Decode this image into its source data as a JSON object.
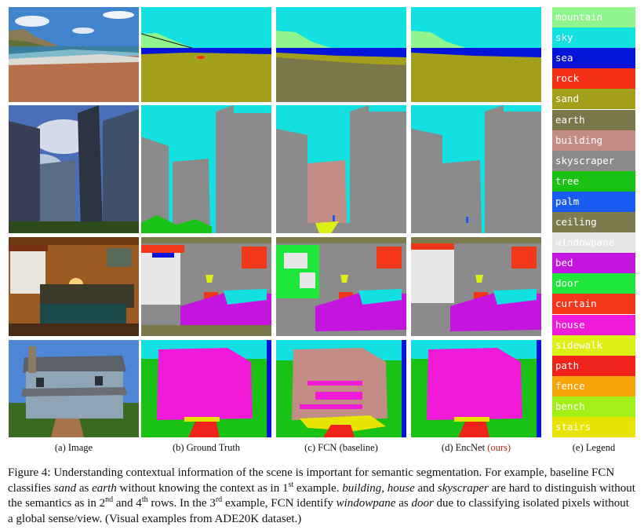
{
  "subcaptions": {
    "image": "(a) Image",
    "ground_truth": "(b) Ground Truth",
    "fcn": "(c) FCN (baseline)",
    "encnet_prefix": "(d) EncNet",
    "encnet_ours": "(ours)",
    "legend": "(e) Legend"
  },
  "legend": [
    {
      "label": "mountain",
      "color": "#8ff58c"
    },
    {
      "label": "sky",
      "color": "#13e0e0"
    },
    {
      "label": "sea",
      "color": "#0414d8"
    },
    {
      "label": "rock",
      "color": "#f52f16"
    },
    {
      "label": "sand",
      "color": "#a29f1b"
    },
    {
      "label": "earth",
      "color": "#7a774b"
    },
    {
      "label": "building",
      "color": "#c38c85"
    },
    {
      "label": "skyscraper",
      "color": "#8b8b8b"
    },
    {
      "label": "tree",
      "color": "#19c214"
    },
    {
      "label": "palm",
      "color": "#1a5bf2"
    },
    {
      "label": "ceiling",
      "color": "#7e7c4e"
    },
    {
      "label": "windowpane",
      "color": "#e6e6e6"
    },
    {
      "label": "bed",
      "color": "#c414e0"
    },
    {
      "label": "door",
      "color": "#1fe63a"
    },
    {
      "label": "curtain",
      "color": "#f2361a"
    },
    {
      "label": "house",
      "color": "#ef1bd9"
    },
    {
      "label": "sidewalk",
      "color": "#ddef15"
    },
    {
      "label": "path",
      "color": "#f0221c"
    },
    {
      "label": "fence",
      "color": "#f5a40a"
    },
    {
      "label": "bench",
      "color": "#a2ef1a"
    },
    {
      "label": "stairs",
      "color": "#e6e400"
    }
  ],
  "caption": {
    "p1": "Figure 4: Understanding contextual information of the scene is important for semantic segmentation. For example, baseline FCN classifies ",
    "w_sand": "sand",
    "p2": " as ",
    "w_earth": "earth",
    "p3": " without knowing the context as in 1",
    "sup1": "st",
    "p4": " example. ",
    "w_building": "building",
    "p5": ", ",
    "w_house": "house",
    "p6": " and ",
    "w_skyscraper": "skyscraper",
    "p7": " are hard to distinguish without the semantics as in 2",
    "sup2": "nd",
    "p8": " and 4",
    "sup3": "th",
    "p9": " rows. In the 3",
    "sup4": "rd",
    "p10": " example, FCN identify ",
    "w_windowpane": "windowpane",
    "p11": " as ",
    "w_door": "door",
    "p12": " due to classifying isolated pixels without a global sense/view. (Visual examples from ADE20K dataset.)"
  }
}
